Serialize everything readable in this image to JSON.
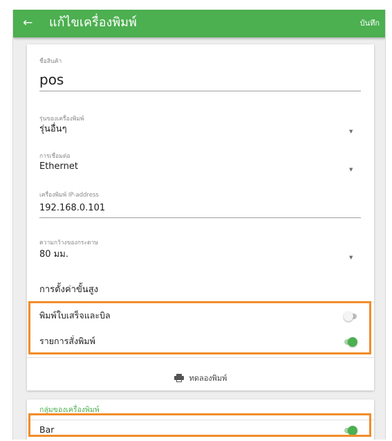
{
  "appbar": {
    "back_icon": "arrow-left-icon",
    "back_glyph": "←",
    "title": "แก้ไขเครื่องพิมพ์",
    "save_label": "บันทึก",
    "color": "#4caf50"
  },
  "form": {
    "product_name": {
      "label": "ชื่อสินค้า",
      "value": "pos"
    },
    "printer_model": {
      "label": "รุ่นของเครื่องพิมพ์",
      "value": "รุ่นอื่นๆ"
    },
    "connection": {
      "label": "การเชื่อมต่อ",
      "value": "Ethernet"
    },
    "ip_address": {
      "label": "เครื่องพิมพ์ IP-address",
      "value": "192.168.0.101"
    },
    "paper_width": {
      "label": "ความกว้างของกระดาษ",
      "value": "80 มม."
    },
    "dropdown_icon": "caret-down-icon",
    "dropdown_glyph": "▼"
  },
  "advanced": {
    "title": "การตั้งค่าขั้นสูง",
    "options": [
      {
        "label": "พิมพ์ใบเสร็จและบิล",
        "enabled": false
      },
      {
        "label": "รายการสั่งพิมพ์",
        "enabled": true
      }
    ]
  },
  "test_print": {
    "icon": "printer-icon",
    "label": "ทดลองพิมพ์"
  },
  "printer_group": {
    "title": "กลุ่มของเครื่องพิมพ์",
    "items": [
      {
        "label": "Bar",
        "enabled": true
      }
    ]
  },
  "colors": {
    "accent": "#4caf50",
    "highlight": "#f28c28"
  }
}
